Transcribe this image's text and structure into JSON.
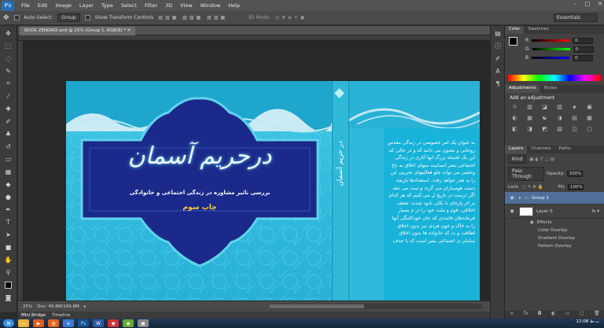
{
  "app": {
    "logo": "Ps",
    "menus": [
      "File",
      "Edit",
      "Image",
      "Layer",
      "Type",
      "Select",
      "Filter",
      "3D",
      "View",
      "Window",
      "Help"
    ],
    "win_controls": [
      "–",
      "□",
      "✕"
    ]
  },
  "options": {
    "auto_select_label": "Auto-Select:",
    "auto_select_value": "Group",
    "transform_label": "Show Transform Controls",
    "mode_3d": "3D Mode:",
    "workspace": "Essentials"
  },
  "document": {
    "tab_title": "BOOK ZENDAGI.psd @ 25% (Group 1, RGB/8) *",
    "zoom": "25%",
    "doc_size": "Doc: 49.8M/169.8M"
  },
  "cover": {
    "title": "درحریم آسمان",
    "subtitle": "بررسی تاثیر مشاوره در زندگی اجتماعی و خانوادگی",
    "edition": "چاپ سوم",
    "spine_title": "در حریم آسمان",
    "back_text": "به عنوان یک امر خصوصی در زندگی مقدس روحانی و معنوی می دانند که و در حالی که این یک اشتباه بزرگ انها آثاری در زندگی اجتماعی بشر انسانیت منهای اخلاق به باغ وحشی می تواند جلو فعالیتهای تخریبی این را به هدر خواهد رفت. استعدادها بازیچه دست هوسبازان می گردد و ست می دهد. اگر درست در تاریخ ل می کنیم که هر کدام بر اثر پاره‌ای با بکلی نابود شدند. ضعف اخلاقی، قوم و ملت خود را در م بسیار فرماندهان فاسدی که جان خودکامگی آنها را به خاک و خون فردی نیز بدون اخلاق لطافت و ت که خانواده ها بدون اخلاق سامان ی اجتماعی بشر است که با حذف"
  },
  "bottom_tabs": [
    "Mini Bridge",
    "Timeline"
  ],
  "color_panel": {
    "tabs": [
      "Color",
      "Swatches"
    ],
    "channels": [
      {
        "name": "R",
        "value": "0",
        "color": "#d33"
      },
      {
        "name": "G",
        "value": "0",
        "color": "#3b3"
      },
      {
        "name": "B",
        "value": "0",
        "color": "#37c"
      }
    ]
  },
  "adjustments": {
    "tabs": [
      "Adjustments",
      "Styles"
    ],
    "heading": "Add an adjustment",
    "icons": [
      "☼",
      "▥",
      "◪",
      "▨",
      "◈",
      "▣",
      "◐",
      "▦",
      "☯",
      "◑",
      "▤",
      "▩",
      "◧",
      "◨",
      "◩",
      "▧",
      "◫",
      "▢"
    ]
  },
  "layers": {
    "tabs": [
      "Layers",
      "Channels",
      "Paths"
    ],
    "kind": "Kind",
    "blend": "Pass Through",
    "opacity_label": "Opacity:",
    "opacity": "100%",
    "lock_label": "Lock:",
    "fill_label": "Fill:",
    "fill": "100%",
    "rows": [
      {
        "name": "Group 1"
      },
      {
        "name": "Layer 0"
      }
    ],
    "effects_label": "Effects",
    "effects": [
      "Color Overlay",
      "Gradient Overlay",
      "Pattern Overlay"
    ]
  },
  "taskbar": {
    "clock": "12:08 ب.ظ"
  }
}
